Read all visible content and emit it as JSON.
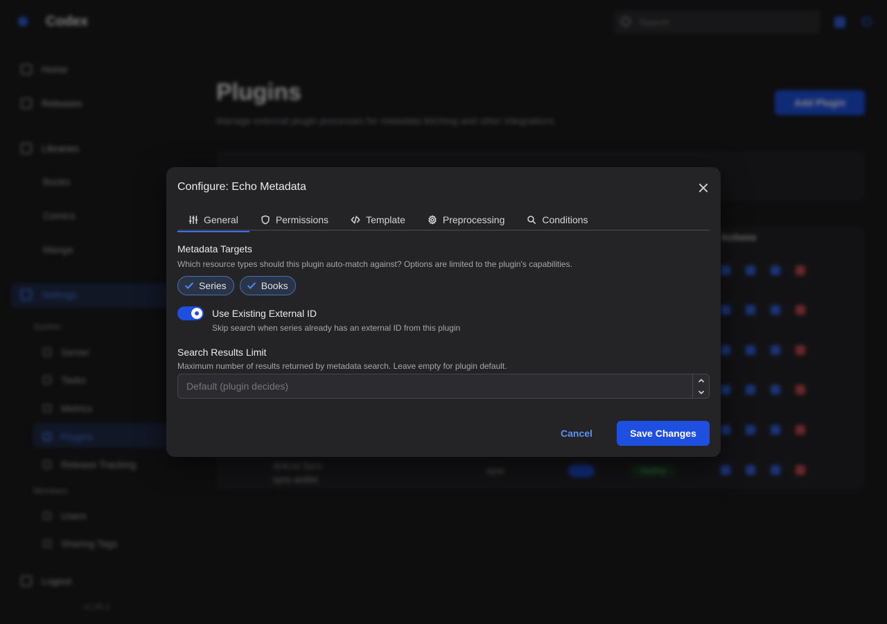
{
  "app": {
    "name": "Codex",
    "search_placeholder": "Search",
    "version": "v1.00.1"
  },
  "sidebar": {
    "home": "Home",
    "releases": "Releases",
    "libraries": "Libraries",
    "library_items": [
      "Books",
      "Comics",
      "Manga"
    ],
    "settings": "Settings",
    "system_label": "System",
    "system_items": [
      "Server",
      "Tasks",
      "Metrics",
      "Plugins",
      "Release Tracking"
    ],
    "members_label": "Members",
    "members_items": [
      "Users",
      "Sharing Tags"
    ],
    "logout": "Logout"
  },
  "main": {
    "title": "Plugins",
    "subtitle": "Manage external plugin processes for metadata fetching and other integrations",
    "add_button": "Add Plugin",
    "actions_header": "Actions",
    "last_row": {
      "name": "AniList Sync",
      "id": "sync-anilist",
      "type": "sync",
      "status": "Healthy"
    }
  },
  "dialog": {
    "title": "Configure: Echo Metadata",
    "tabs": [
      {
        "label": "General",
        "icon": "sliders-icon"
      },
      {
        "label": "Permissions",
        "icon": "shield-icon"
      },
      {
        "label": "Template",
        "icon": "code-icon"
      },
      {
        "label": "Preprocessing",
        "icon": "gear-icon"
      },
      {
        "label": "Conditions",
        "icon": "search-icon"
      }
    ],
    "active_tab": "General",
    "metadata_targets": {
      "title": "Metadata Targets",
      "description": "Which resource types should this plugin auto-match against? Options are limited to the plugin's capabilities.",
      "chips": [
        "Series",
        "Books"
      ]
    },
    "external_id": {
      "label": "Use Existing External ID",
      "description": "Skip search when series already has an external ID from this plugin",
      "enabled": true
    },
    "search_limit": {
      "title": "Search Results Limit",
      "description": "Maximum number of results returned by metadata search. Leave empty for plugin default.",
      "placeholder": "Default (plugin decides)",
      "value": ""
    },
    "cancel_label": "Cancel",
    "save_label": "Save Changes"
  },
  "colors": {
    "accent": "#1f4fe0",
    "link": "#5b92f2",
    "dialog_bg": "#242427",
    "page_bg": "#1a1a1c"
  }
}
